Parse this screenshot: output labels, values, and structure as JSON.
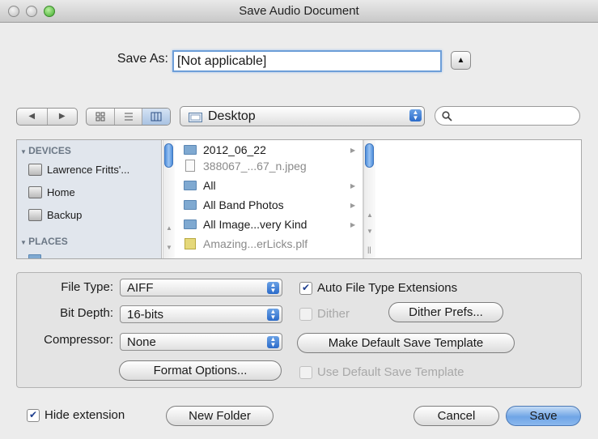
{
  "window": {
    "title": "Save Audio Document"
  },
  "save_as": {
    "label": "Save As:",
    "value": "[Not applicable]"
  },
  "toolbar": {
    "back_icon": "back-triangle",
    "forward_icon": "forward-triangle",
    "view_icons": [
      "icon-view",
      "list-view",
      "column-view"
    ],
    "location": "Desktop",
    "search_placeholder": ""
  },
  "sidebar": {
    "devices_header": "DEVICES",
    "devices": [
      "Lawrence Fritts'...",
      "Home",
      "Backup"
    ],
    "places_header": "PLACES"
  },
  "files": [
    {
      "name": "2012_06_22",
      "kind": "folder",
      "enabled": true
    },
    {
      "name": "388067_...67_n.jpeg",
      "kind": "file",
      "enabled": false
    },
    {
      "name": "All",
      "kind": "folder",
      "enabled": true
    },
    {
      "name": "All Band Photos",
      "kind": "folder",
      "enabled": true
    },
    {
      "name": "All Image...very Kind",
      "kind": "folder",
      "enabled": true
    },
    {
      "name": "Amazing...erLicks.plf",
      "kind": "plugin",
      "enabled": false
    }
  ],
  "options": {
    "file_type": {
      "label": "File Type:",
      "value": "AIFF"
    },
    "bit_depth": {
      "label": "Bit Depth:",
      "value": "16-bits"
    },
    "compressor": {
      "label": "Compressor:",
      "value": "None"
    },
    "format_options": "Format Options...",
    "auto_ext": {
      "label": "Auto File Type Extensions",
      "checked": true
    },
    "dither": {
      "label": "Dither",
      "checked": false,
      "enabled": false
    },
    "dither_prefs": "Dither Prefs...",
    "make_default": "Make Default Save Template",
    "use_default": {
      "label": "Use Default Save Template",
      "checked": false,
      "enabled": false
    }
  },
  "footer": {
    "hide_extension": {
      "label": "Hide extension",
      "checked": true
    },
    "new_folder": "New Folder",
    "cancel": "Cancel",
    "save": "Save"
  }
}
